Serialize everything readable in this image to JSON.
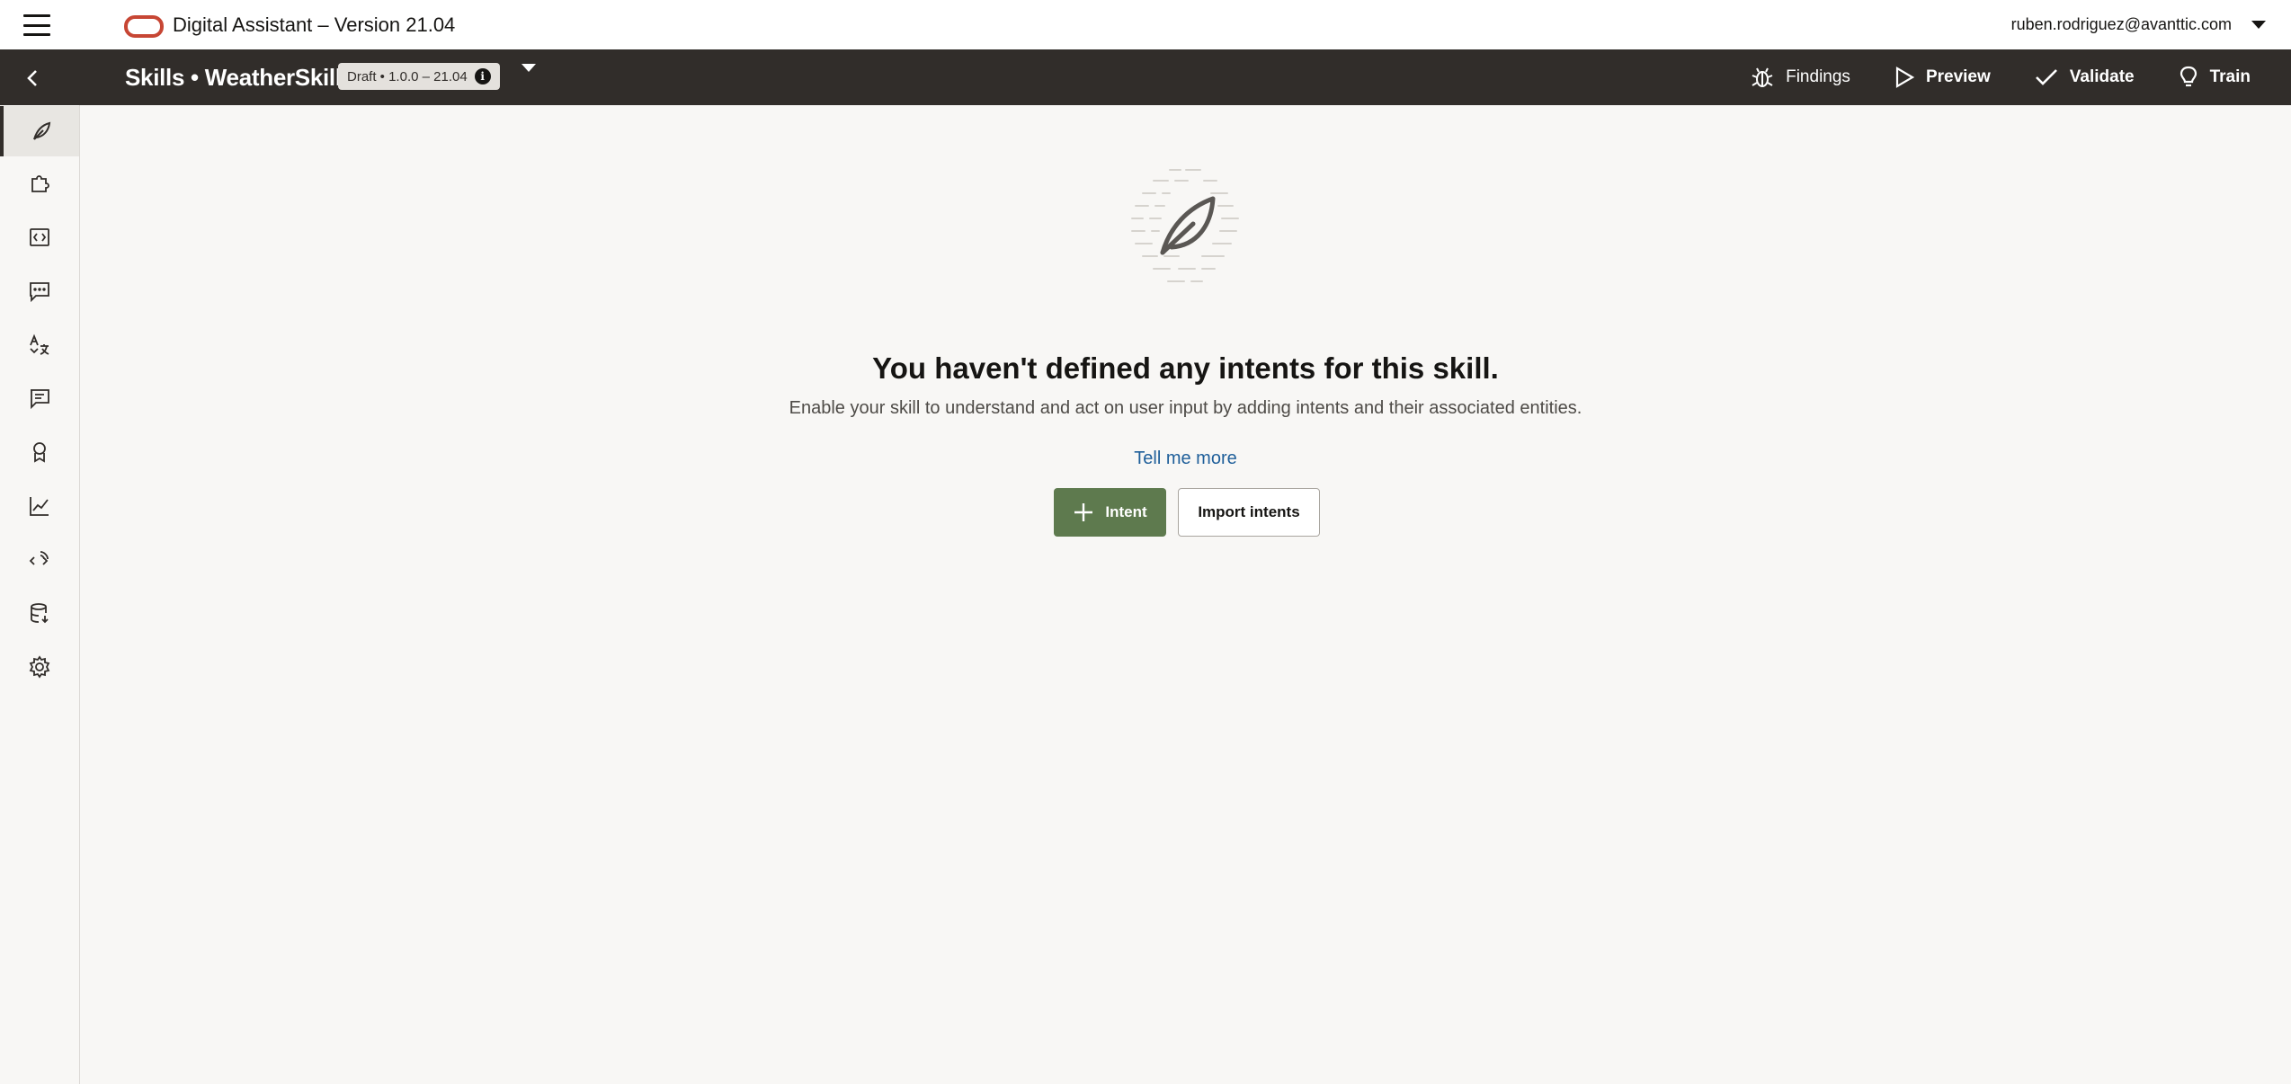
{
  "header": {
    "app_title": "Digital Assistant – Version 21.04",
    "user_email": "ruben.rodriguez@avanttic.com",
    "logo_color": "#c74634"
  },
  "skill_bar": {
    "title": "Skills • WeatherSkill",
    "version_badge": "Draft • 1.0.0 – 21.04",
    "info_glyph": "i",
    "background": "#312d2a",
    "toolbar": {
      "findings_label": "Findings",
      "preview_label": "Preview",
      "validate_label": "Validate",
      "train_label": "Train"
    }
  },
  "side_nav": {
    "items": [
      {
        "icon": "intents-feather-icon",
        "active": true
      },
      {
        "icon": "entities-puzzle-icon",
        "active": false
      },
      {
        "icon": "flows-code-icon",
        "active": false
      },
      {
        "icon": "resource-bundles-chat-icon",
        "active": false
      },
      {
        "icon": "language-translate-icon",
        "active": false
      },
      {
        "icon": "qna-chat-icon",
        "active": false
      },
      {
        "icon": "quality-badge-icon",
        "active": false
      },
      {
        "icon": "insights-chart-icon",
        "active": false
      },
      {
        "icon": "components-api-icon",
        "active": false
      },
      {
        "icon": "data-manager-icon",
        "active": false
      },
      {
        "icon": "settings-gear-icon",
        "active": false
      }
    ]
  },
  "main": {
    "empty_title": "You haven't defined any intents for this skill.",
    "empty_description": "Enable your skill to understand and act on user input by adding intents and their associated entities.",
    "tell_more_link": "Tell me more",
    "add_intent_label": "Intent",
    "import_intents_label": "Import intents",
    "primary_color": "#5e7a4e",
    "link_color": "#1f5f9a"
  }
}
